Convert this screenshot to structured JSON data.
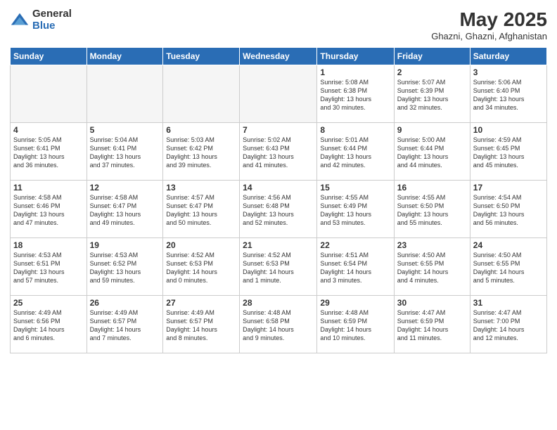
{
  "logo": {
    "general": "General",
    "blue": "Blue"
  },
  "title": "May 2025",
  "location": "Ghazni, Ghazni, Afghanistan",
  "days_of_week": [
    "Sunday",
    "Monday",
    "Tuesday",
    "Wednesday",
    "Thursday",
    "Friday",
    "Saturday"
  ],
  "weeks": [
    [
      {
        "day": "",
        "info": ""
      },
      {
        "day": "",
        "info": ""
      },
      {
        "day": "",
        "info": ""
      },
      {
        "day": "",
        "info": ""
      },
      {
        "day": "1",
        "info": "Sunrise: 5:08 AM\nSunset: 6:38 PM\nDaylight: 13 hours\nand 30 minutes."
      },
      {
        "day": "2",
        "info": "Sunrise: 5:07 AM\nSunset: 6:39 PM\nDaylight: 13 hours\nand 32 minutes."
      },
      {
        "day": "3",
        "info": "Sunrise: 5:06 AM\nSunset: 6:40 PM\nDaylight: 13 hours\nand 34 minutes."
      }
    ],
    [
      {
        "day": "4",
        "info": "Sunrise: 5:05 AM\nSunset: 6:41 PM\nDaylight: 13 hours\nand 36 minutes."
      },
      {
        "day": "5",
        "info": "Sunrise: 5:04 AM\nSunset: 6:41 PM\nDaylight: 13 hours\nand 37 minutes."
      },
      {
        "day": "6",
        "info": "Sunrise: 5:03 AM\nSunset: 6:42 PM\nDaylight: 13 hours\nand 39 minutes."
      },
      {
        "day": "7",
        "info": "Sunrise: 5:02 AM\nSunset: 6:43 PM\nDaylight: 13 hours\nand 41 minutes."
      },
      {
        "day": "8",
        "info": "Sunrise: 5:01 AM\nSunset: 6:44 PM\nDaylight: 13 hours\nand 42 minutes."
      },
      {
        "day": "9",
        "info": "Sunrise: 5:00 AM\nSunset: 6:44 PM\nDaylight: 13 hours\nand 44 minutes."
      },
      {
        "day": "10",
        "info": "Sunrise: 4:59 AM\nSunset: 6:45 PM\nDaylight: 13 hours\nand 45 minutes."
      }
    ],
    [
      {
        "day": "11",
        "info": "Sunrise: 4:58 AM\nSunset: 6:46 PM\nDaylight: 13 hours\nand 47 minutes."
      },
      {
        "day": "12",
        "info": "Sunrise: 4:58 AM\nSunset: 6:47 PM\nDaylight: 13 hours\nand 49 minutes."
      },
      {
        "day": "13",
        "info": "Sunrise: 4:57 AM\nSunset: 6:47 PM\nDaylight: 13 hours\nand 50 minutes."
      },
      {
        "day": "14",
        "info": "Sunrise: 4:56 AM\nSunset: 6:48 PM\nDaylight: 13 hours\nand 52 minutes."
      },
      {
        "day": "15",
        "info": "Sunrise: 4:55 AM\nSunset: 6:49 PM\nDaylight: 13 hours\nand 53 minutes."
      },
      {
        "day": "16",
        "info": "Sunrise: 4:55 AM\nSunset: 6:50 PM\nDaylight: 13 hours\nand 55 minutes."
      },
      {
        "day": "17",
        "info": "Sunrise: 4:54 AM\nSunset: 6:50 PM\nDaylight: 13 hours\nand 56 minutes."
      }
    ],
    [
      {
        "day": "18",
        "info": "Sunrise: 4:53 AM\nSunset: 6:51 PM\nDaylight: 13 hours\nand 57 minutes."
      },
      {
        "day": "19",
        "info": "Sunrise: 4:53 AM\nSunset: 6:52 PM\nDaylight: 13 hours\nand 59 minutes."
      },
      {
        "day": "20",
        "info": "Sunrise: 4:52 AM\nSunset: 6:53 PM\nDaylight: 14 hours\nand 0 minutes."
      },
      {
        "day": "21",
        "info": "Sunrise: 4:52 AM\nSunset: 6:53 PM\nDaylight: 14 hours\nand 1 minute."
      },
      {
        "day": "22",
        "info": "Sunrise: 4:51 AM\nSunset: 6:54 PM\nDaylight: 14 hours\nand 3 minutes."
      },
      {
        "day": "23",
        "info": "Sunrise: 4:50 AM\nSunset: 6:55 PM\nDaylight: 14 hours\nand 4 minutes."
      },
      {
        "day": "24",
        "info": "Sunrise: 4:50 AM\nSunset: 6:55 PM\nDaylight: 14 hours\nand 5 minutes."
      }
    ],
    [
      {
        "day": "25",
        "info": "Sunrise: 4:49 AM\nSunset: 6:56 PM\nDaylight: 14 hours\nand 6 minutes."
      },
      {
        "day": "26",
        "info": "Sunrise: 4:49 AM\nSunset: 6:57 PM\nDaylight: 14 hours\nand 7 minutes."
      },
      {
        "day": "27",
        "info": "Sunrise: 4:49 AM\nSunset: 6:57 PM\nDaylight: 14 hours\nand 8 minutes."
      },
      {
        "day": "28",
        "info": "Sunrise: 4:48 AM\nSunset: 6:58 PM\nDaylight: 14 hours\nand 9 minutes."
      },
      {
        "day": "29",
        "info": "Sunrise: 4:48 AM\nSunset: 6:59 PM\nDaylight: 14 hours\nand 10 minutes."
      },
      {
        "day": "30",
        "info": "Sunrise: 4:47 AM\nSunset: 6:59 PM\nDaylight: 14 hours\nand 11 minutes."
      },
      {
        "day": "31",
        "info": "Sunrise: 4:47 AM\nSunset: 7:00 PM\nDaylight: 14 hours\nand 12 minutes."
      }
    ]
  ]
}
